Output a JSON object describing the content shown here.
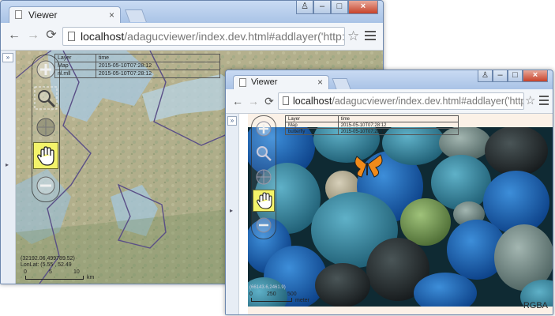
{
  "colors": {
    "window_frame": "#a9c3e6",
    "toolbar": "#f2f5f9",
    "active_tool": "#f3f36a"
  },
  "windows": [
    {
      "tab_title": "Viewer",
      "tab_close": "×",
      "url_host": "localhost",
      "url_path": "/adagucviewer/index.dev.html#addlayer('http://localhos",
      "nav": {
        "back": "←",
        "forward": "→",
        "reload": "⟳"
      },
      "bookmark_star": "☆",
      "expand_label": "»",
      "layer_table": {
        "headers": [
          "Layer",
          "time"
        ],
        "rows": [
          [
            "Map",
            "2015-05-10T07:28:12"
          ],
          [
            "nl.mll",
            "2015-05-10T07:28:12"
          ]
        ]
      },
      "coords": [
        "(32192.06,499789.52)",
        "LonLat: (5.55 , 52.49"
      ],
      "scale": {
        "labels": [
          "0",
          "5",
          "10"
        ],
        "unit": "km"
      }
    },
    {
      "tab_title": "Viewer",
      "tab_close": "×",
      "url_host": "localhost",
      "url_path": "/adagucviewer/index.dev.html#addlayer('http://localhos",
      "nav": {
        "back": "←",
        "forward": "→",
        "reload": "⟳"
      },
      "bookmark_star": "☆",
      "expand_label": "»",
      "layer_table": {
        "headers": [
          "Layer",
          "time"
        ],
        "rows": [
          [
            "Map",
            "2015-05-10T07:28:12"
          ],
          [
            "butterfly",
            "2015-05-10T07:28:12"
          ]
        ]
      },
      "coords": [
        "(66143.6,2461.9)"
      ],
      "scale": {
        "labels": [
          "0",
          "250",
          "500"
        ],
        "unit": "meter"
      },
      "status": "RGBA"
    }
  ]
}
